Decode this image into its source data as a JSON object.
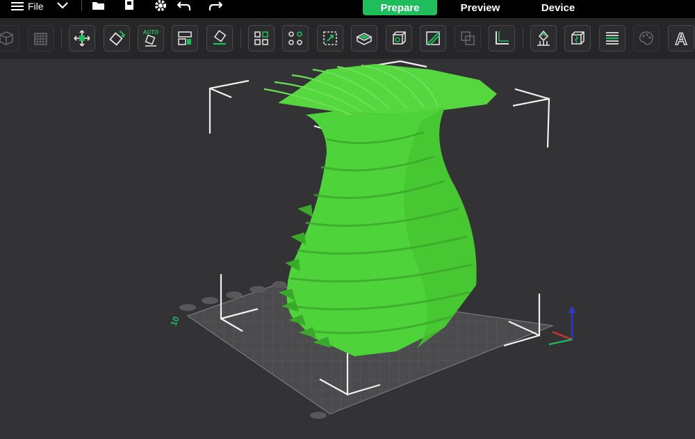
{
  "topbar": {
    "file_label": "File",
    "tabs": [
      "Prepare",
      "Preview",
      "Device"
    ],
    "active_tab": "Prepare"
  },
  "toolbar": {
    "auto_badge": "AUTO",
    "text_tool_glyph": "A",
    "icons": [
      "add-object-icon",
      "add-plate-icon",
      "move-icon",
      "rotate-icon",
      "auto-orient-icon",
      "arrange-icon",
      "lay-on-face-icon",
      "split-objects-icon",
      "split-parts-icon",
      "fit-to-plate-icon",
      "cut-icon",
      "bounding-box-icon",
      "slice-plane-icon",
      "boolean-icon",
      "measure-icon",
      "support-painting-icon",
      "seam-painting-icon",
      "variable-layer-icon",
      "color-painting-icon",
      "text-tool-icon"
    ]
  },
  "viewport": {
    "plate_label": "10",
    "accent": "#1fbd5c",
    "model_color": "#4fd33a"
  }
}
